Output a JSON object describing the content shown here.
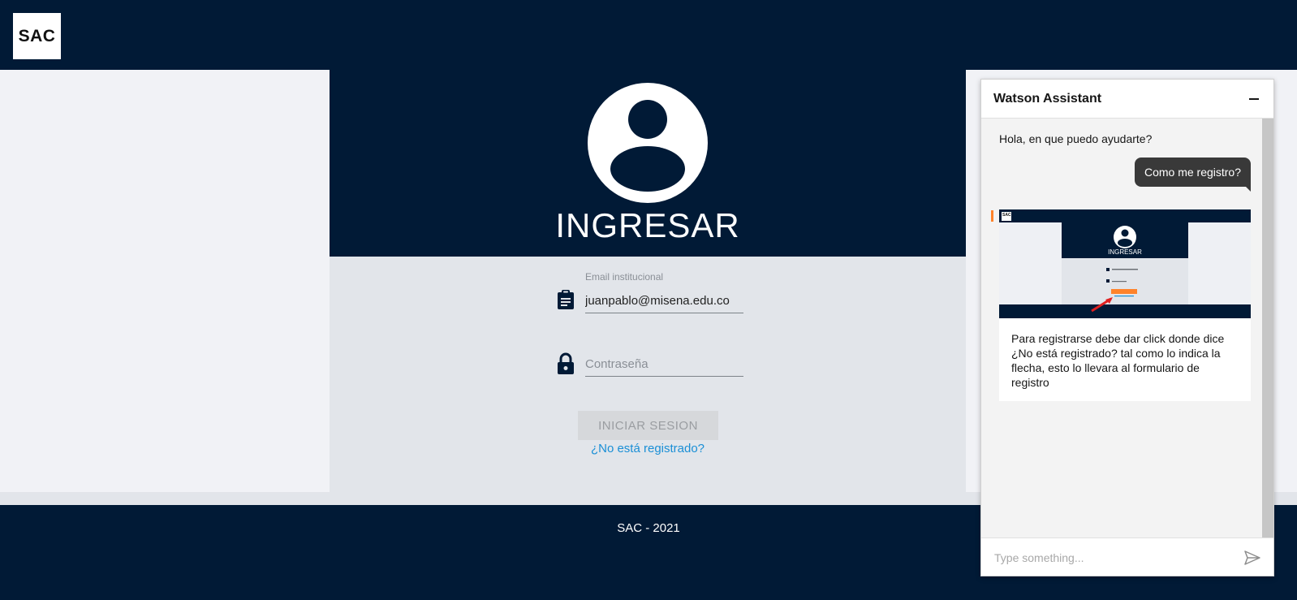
{
  "app": {
    "logo_text": "SAC"
  },
  "login": {
    "title": "INGRESAR",
    "email": {
      "label": "Email institucional",
      "value": "juanpablo@misena.edu.co"
    },
    "password": {
      "placeholder": "Contraseña"
    },
    "submit_label": "INICIAR SESION",
    "register_link": "¿No está registrado?"
  },
  "footer": {
    "text": "SAC - 2021"
  },
  "chat": {
    "title": "Watson Assistant",
    "greeting": "Hola, en que puedo ayudarte?",
    "user_message": "Como me registro?",
    "bot_card_text": "Para registrarse debe dar click donde dice ¿No está registrado? tal como lo indica la flecha, esto lo llevara al formulario de registro",
    "bot_image_logo": "SAC",
    "bot_image_title": "INGRESAR",
    "input_placeholder": "Type something..."
  },
  "colors": {
    "navy": "#011a36",
    "link": "#1a8fd6",
    "accent_orange": "#ff832b"
  },
  "icons": {
    "avatar": "user-circle-icon",
    "email": "clipboard-icon",
    "password": "lock-icon",
    "chat_minimize": "minus-icon",
    "chat_send": "send-icon"
  }
}
